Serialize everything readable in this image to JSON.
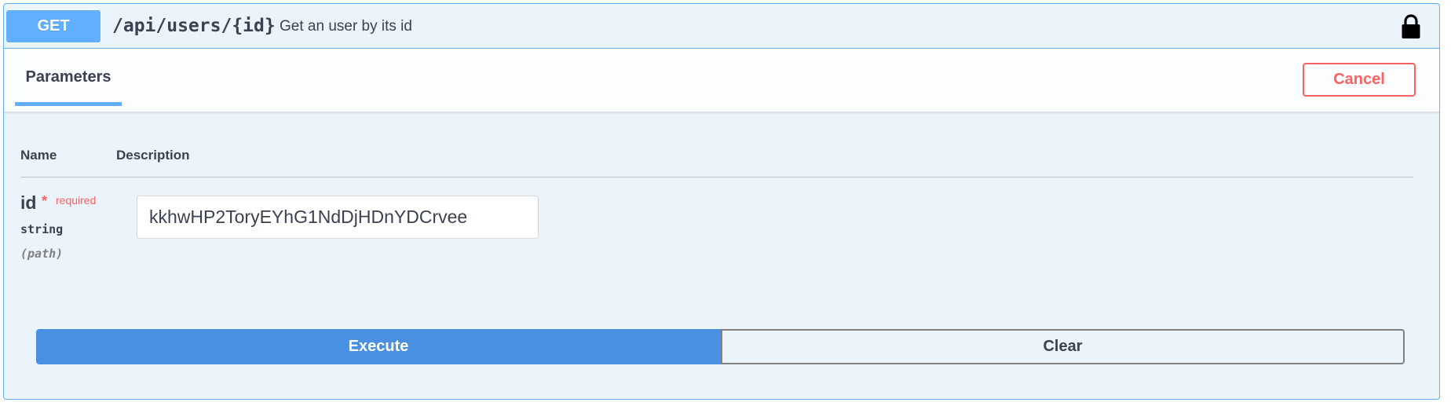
{
  "operation": {
    "method": "GET",
    "path": "/api/users/{id}",
    "description": "Get an user by its id",
    "lock_icon": "lock-icon"
  },
  "tabs": {
    "parameters_label": "Parameters",
    "cancel_label": "Cancel"
  },
  "table": {
    "headers": [
      "Name",
      "Description"
    ]
  },
  "parameters": [
    {
      "name": "id",
      "required_star": "*",
      "required_label": "required",
      "type": "string",
      "in": "(path)",
      "value": "kkhwHP2ToryEYhG1NdDjHDnYDCrvee"
    }
  ],
  "actions": {
    "execute_label": "Execute",
    "clear_label": "Clear"
  },
  "colors": {
    "get_method": "#61affe",
    "block_background": "#ebf3fb",
    "cancel": "#ff6060",
    "execute": "#4990e2",
    "text": "#3b4151"
  }
}
